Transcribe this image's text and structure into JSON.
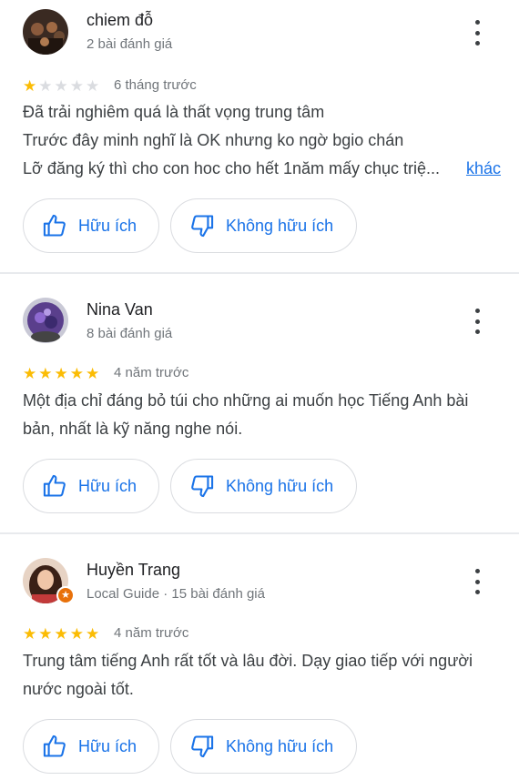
{
  "reviews": [
    {
      "name": "chiem đỗ",
      "meta": "2 bài đánh giá",
      "rating": 1,
      "time": "6 tháng trước",
      "lines": [
        "Đã trải nghiêm quá là thất vọng trung tâm",
        "Trước đây minh nghĩ là OK nhưng ko ngờ bgio chán",
        "Lỡ đăng ký thì cho con hoc cho hết 1năm mấy chục triệ..."
      ],
      "more_label": "khác",
      "helpful_label": "Hữu ích",
      "unhelpful_label": "Không hữu ích"
    },
    {
      "name": "Nina Van",
      "meta": "8 bài đánh giá",
      "rating": 5,
      "time": "4 năm trước",
      "lines": [
        "Một địa chỉ đáng bỏ túi cho những ai muốn học Tiếng Anh bài",
        "bản, nhất là kỹ năng nghe nói."
      ],
      "helpful_label": "Hữu ích",
      "unhelpful_label": "Không hữu ích"
    },
    {
      "name": "Huyền Trang",
      "meta": "Local Guide · 15 bài đánh giá",
      "rating": 5,
      "time": "4 năm trước",
      "lines": [
        "Trung tâm tiếng Anh rất tốt và lâu đời. Dạy giao tiếp với người",
        "nước ngoài tốt."
      ],
      "helpful_label": "Hữu ích",
      "unhelpful_label": "Không hữu ích"
    }
  ],
  "colors": {
    "star_filled": "#fbbc04",
    "star_empty": "#dadce0",
    "link": "#1a73e8",
    "local_guide_badge": "#e8710a"
  },
  "icons": {
    "thumb_up": "thumbs-up-icon",
    "thumb_down": "thumbs-down-icon",
    "more": "more-vert-icon"
  }
}
